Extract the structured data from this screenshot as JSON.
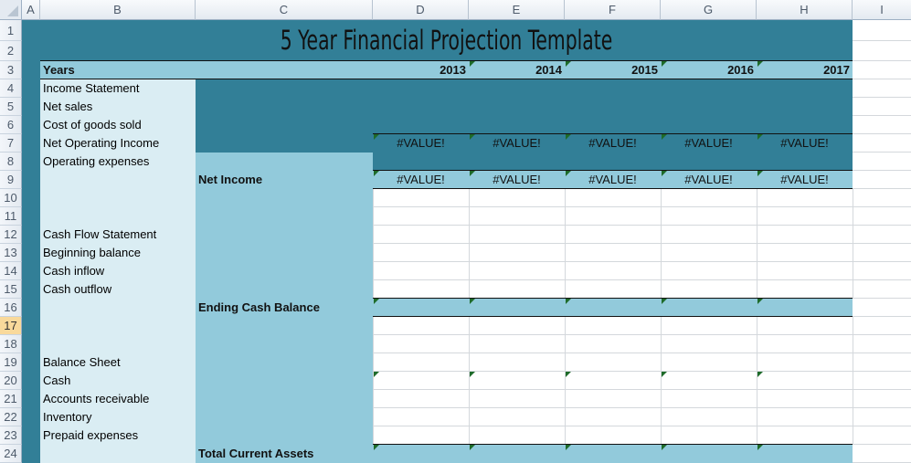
{
  "sheet": {
    "columns": [
      "A",
      "B",
      "C",
      "D",
      "E",
      "F",
      "G",
      "H",
      "I"
    ],
    "rows": [
      "1",
      "2",
      "3",
      "4",
      "5",
      "6",
      "7",
      "8",
      "9",
      "10",
      "11",
      "12",
      "13",
      "14",
      "15",
      "16",
      "17",
      "18",
      "19",
      "20",
      "21",
      "22",
      "23",
      "24"
    ],
    "selected_row": "17"
  },
  "title": "5 Year Financial Projection Template",
  "years_label": "Years",
  "years": [
    "2013",
    "2014",
    "2015",
    "2016",
    "2017"
  ],
  "labels": {
    "r4": "Income Statement",
    "r5": "Net sales",
    "r6": "Cost of goods sold",
    "r7": "Net Operating Income",
    "r8": "Operating expenses",
    "r12": "Cash Flow Statement",
    "r13": "Beginning balance",
    "r14": "Cash inflow",
    "r15": "Cash outflow",
    "r19": "Balance Sheet",
    "r20": "Cash",
    "r21": "Accounts receivable",
    "r22": "Inventory",
    "r23": "Prepaid expenses"
  },
  "totals": {
    "net_income": "Net Income",
    "ending_cash": "Ending Cash Balance",
    "total_current_assets": "Total Current Assets"
  },
  "row7_values": [
    "#VALUE!",
    "#VALUE!",
    "#VALUE!",
    "#VALUE!",
    "#VALUE!"
  ],
  "row9_values": [
    "#VALUE!",
    "#VALUE!",
    "#VALUE!",
    "#VALUE!",
    "#VALUE!"
  ],
  "colors": {
    "dark_teal": "#327f97",
    "light_blue": "#92cadb",
    "pale_blue": "#daedf3",
    "error_indicator": "#1e6b2a",
    "selected_row_header": "#f9d99b"
  }
}
